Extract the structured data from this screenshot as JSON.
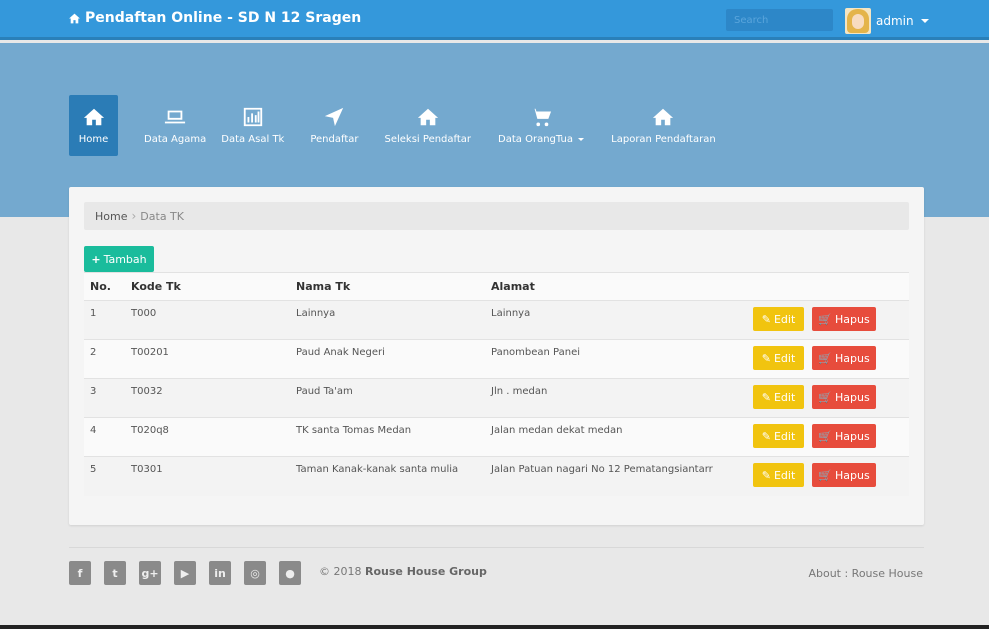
{
  "header": {
    "brand": "Pendaftan Online - SD N 12 Sragen",
    "search_placeholder": "Search",
    "user": "admin"
  },
  "nav": [
    {
      "label": "Home",
      "icon": "home-icon"
    },
    {
      "label": "Data Agama",
      "icon": "laptop-icon"
    },
    {
      "label": "Data Asal Tk",
      "icon": "bar-chart-icon"
    },
    {
      "label": "Pendaftar",
      "icon": "location-arrow-icon"
    },
    {
      "label": "Seleksi Pendaftar",
      "icon": "home-icon"
    },
    {
      "label": "Data OrangTua",
      "icon": "cart-icon"
    },
    {
      "label": "Laporan Pendaftaran",
      "icon": "home-icon"
    }
  ],
  "breadcrumb": {
    "home": "Home",
    "current": "Data TK"
  },
  "add_button": "Tambah",
  "table": {
    "headers": [
      "No.",
      "Kode Tk",
      "Nama Tk",
      "Alamat"
    ],
    "rows": [
      {
        "no": "1",
        "kode": "T000",
        "nama": "Lainnya",
        "alamat": "Lainnya"
      },
      {
        "no": "2",
        "kode": "T00201",
        "nama": "Paud Anak Negeri",
        "alamat": "Panombean Panei"
      },
      {
        "no": "3",
        "kode": "T0032",
        "nama": "Paud Ta'am",
        "alamat": "Jln . medan"
      },
      {
        "no": "4",
        "kode": "T020q8",
        "nama": "TK santa Tomas Medan",
        "alamat": "Jalan medan dekat medan"
      },
      {
        "no": "5",
        "kode": "T0301",
        "nama": "Taman Kanak-kanak santa mulia",
        "alamat": "Jalan Patuan nagari No 12 Pematangsiantarr"
      }
    ],
    "edit_label": "Edit",
    "delete_label": "Hapus"
  },
  "footer": {
    "social": [
      "facebook-icon",
      "twitter-icon",
      "google-plus-icon",
      "youtube-icon",
      "linkedin-icon",
      "instagram-icon",
      "github-icon"
    ],
    "copyright_prefix": "© 2018",
    "copyright_name": "Rouse House Group",
    "about": "About : Rouse House"
  },
  "colors": {
    "topbar": "#3498db",
    "hero": "#74a9cf",
    "active_nav": "#2b7cb6",
    "add": "#1abc9c",
    "edit": "#f1c40f",
    "delete": "#e74c3c"
  }
}
